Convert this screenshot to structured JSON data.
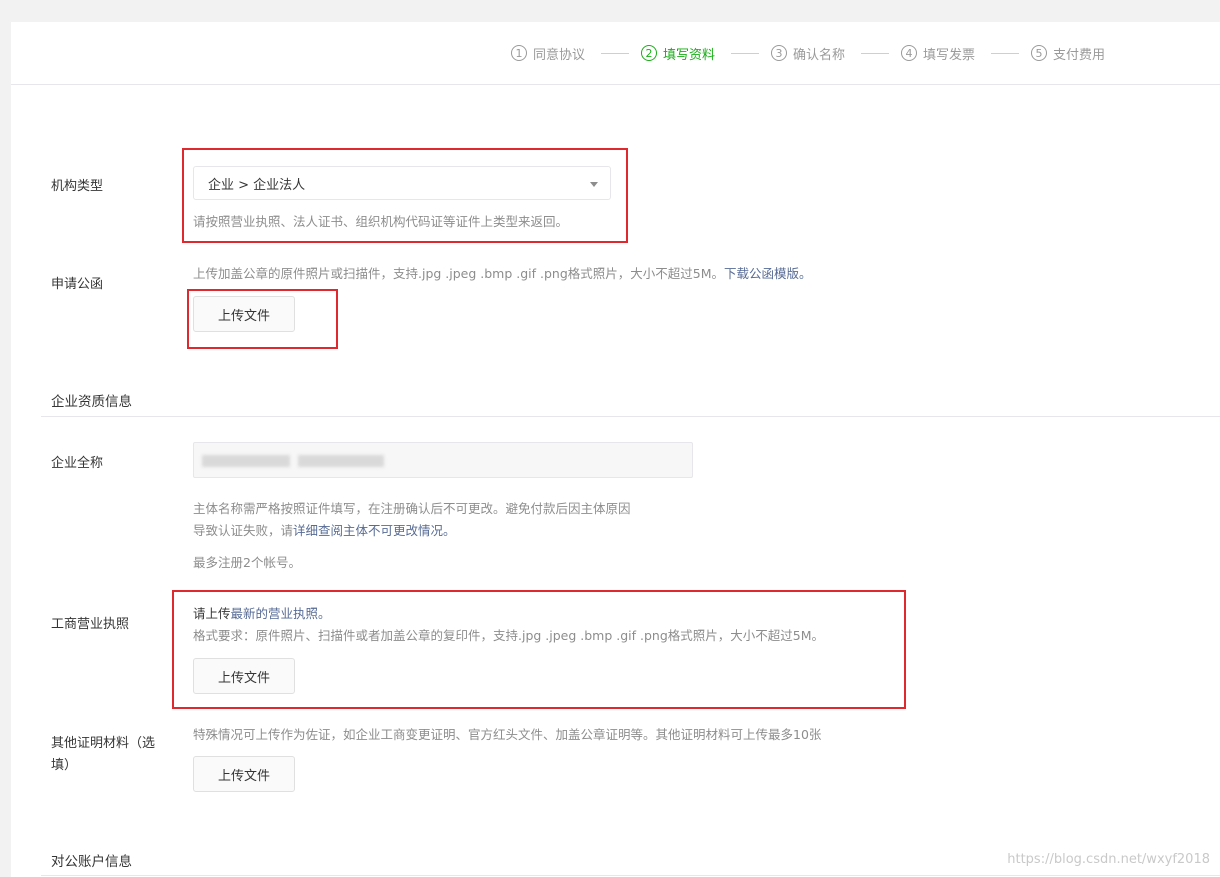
{
  "steps": [
    {
      "num": "1",
      "label": "同意协议",
      "active": false
    },
    {
      "num": "2",
      "label": "填写资料",
      "active": true
    },
    {
      "num": "3",
      "label": "确认名称",
      "active": false
    },
    {
      "num": "4",
      "label": "填写发票",
      "active": false
    },
    {
      "num": "5",
      "label": "支付费用",
      "active": false
    }
  ],
  "org_type": {
    "label": "机构类型",
    "selected": "企业 > 企业法人",
    "tip": "请按照营业执照、法人证书、组织机构代码证等证件上类型来返回。"
  },
  "letter": {
    "label": "申请公函",
    "tip": "上传加盖公章的原件照片或扫描件，支持.jpg .jpeg .bmp .gif .png格式照片，大小不超过5M。",
    "tip_link": "下载公函模版。",
    "button": "上传文件"
  },
  "qualification": {
    "section_title": "企业资质信息",
    "name_label": "企业全称",
    "name_tip_1": "主体名称需严格按照证件填写，在注册确认后不可更改。避免付款后因主体原因",
    "name_tip_2_prefix": "导致认证失败，请",
    "name_tip_2_link": "详细查阅主体不可更改情况。",
    "name_tip_3": "最多注册2个帐号。"
  },
  "license": {
    "label": "工商营业执照",
    "tip_prefix": "请上传",
    "tip_link": "最新的营业执照。",
    "tip_2": "格式要求：原件照片、扫描件或者加盖公章的复印件，支持.jpg .jpeg .bmp .gif .png格式照片，大小不超过5M。",
    "button": "上传文件"
  },
  "other": {
    "label_1": "其他证明材料（选",
    "label_2": "填）",
    "tip": "特殊情况可上传作为佐证，如企业工商变更证明、官方红头文件、加盖公章证明等。其他证明材料可上传最多10张",
    "button": "上传文件"
  },
  "account": {
    "section_title": "对公账户信息"
  },
  "watermark": "https://blog.csdn.net/wxyf2018",
  "colors": {
    "active_green": "#1aad19",
    "link_blue": "#576b95",
    "highlight_red": "#e0282f"
  }
}
